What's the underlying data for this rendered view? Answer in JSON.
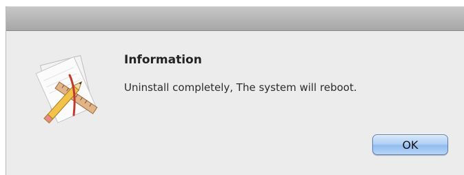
{
  "dialog": {
    "icon": "script-editor-app-icon",
    "title": "Information",
    "message": "Uninstall completely, The system will reboot.",
    "ok_label": "OK"
  },
  "colors": {
    "dialog_bg": "#ececec",
    "button_blue": "#9cc3f2",
    "text": "#222222"
  }
}
